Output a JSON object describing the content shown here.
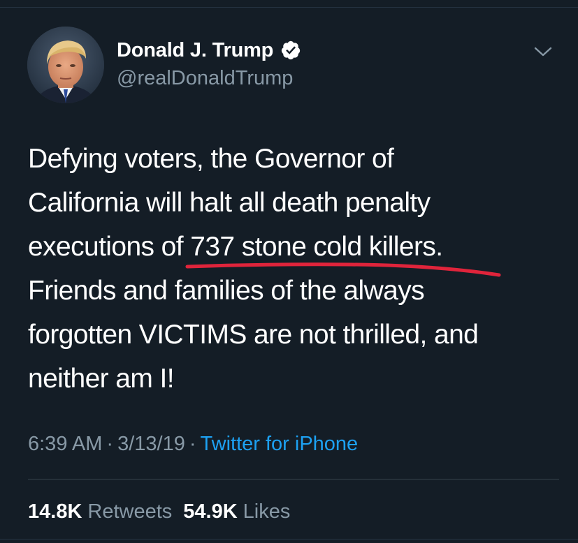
{
  "colors": {
    "background": "#141d26",
    "text_primary": "#ffffff",
    "text_secondary": "#8899a6",
    "link": "#1da1f2",
    "verified_badge": "#ffffff",
    "underline_annotation": "#e0243b"
  },
  "user": {
    "display_name": "Donald J. Trump",
    "handle": "@realDonaldTrump",
    "verified": true,
    "verified_icon": "verified-badge-icon",
    "avatar_icon": "avatar"
  },
  "header": {
    "menu_icon": "chevron-down-icon"
  },
  "tweet": {
    "lines": [
      "Defying voters, the Governor of",
      "California will halt all death penalty",
      "executions of 737 stone cold killers.",
      "Friends and families of the always",
      "forgotten VICTIMS are not thrilled, and",
      "neither am I!"
    ],
    "time": "6:39 AM",
    "date": "3/13/19",
    "separator": "·",
    "source": "Twitter for iPhone"
  },
  "stats": {
    "retweets_count": "14.8K",
    "retweets_label": "Retweets",
    "likes_count": "54.9K",
    "likes_label": "Likes"
  }
}
